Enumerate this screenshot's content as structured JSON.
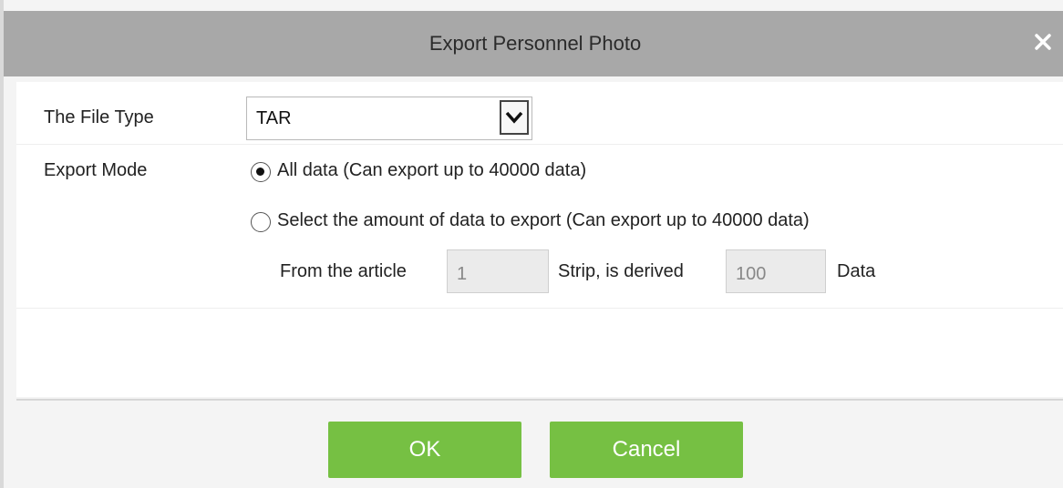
{
  "dialog": {
    "title": "Export Personnel Photo",
    "close_icon": "close-icon"
  },
  "form": {
    "file_type_label": "The File Type",
    "file_type_value": "TAR",
    "export_mode_label": "Export Mode",
    "options": [
      {
        "label": "All data (Can export up to 40000 data)",
        "selected": true
      },
      {
        "label": "Select the amount of data to export (Can export up to 40000 data)",
        "selected": false
      }
    ],
    "range": {
      "from_label": "From the article",
      "from_value": "1",
      "strip_label": "Strip, is derived",
      "count_value": "100",
      "data_label": "Data"
    }
  },
  "buttons": {
    "ok_label": "OK",
    "cancel_label": "Cancel"
  },
  "colors": {
    "titlebar": "#a8a8a8",
    "button_green": "#76c043"
  }
}
